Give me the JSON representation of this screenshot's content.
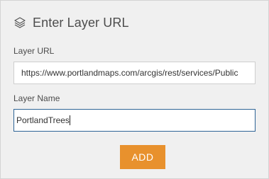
{
  "dialog": {
    "title": "Enter Layer URL",
    "header_icon": "layers-icon"
  },
  "url_field": {
    "label": "Layer URL",
    "value": "https://www.portlandmaps.com/arcgis/rest/services/Public"
  },
  "name_field": {
    "label": "Layer Name",
    "value": "PortlandTrees"
  },
  "add_button": {
    "label": "ADD",
    "color": "#e8912d"
  },
  "colors": {
    "panel_background": "#f0f0f0",
    "focus_border": "#2d6496"
  }
}
